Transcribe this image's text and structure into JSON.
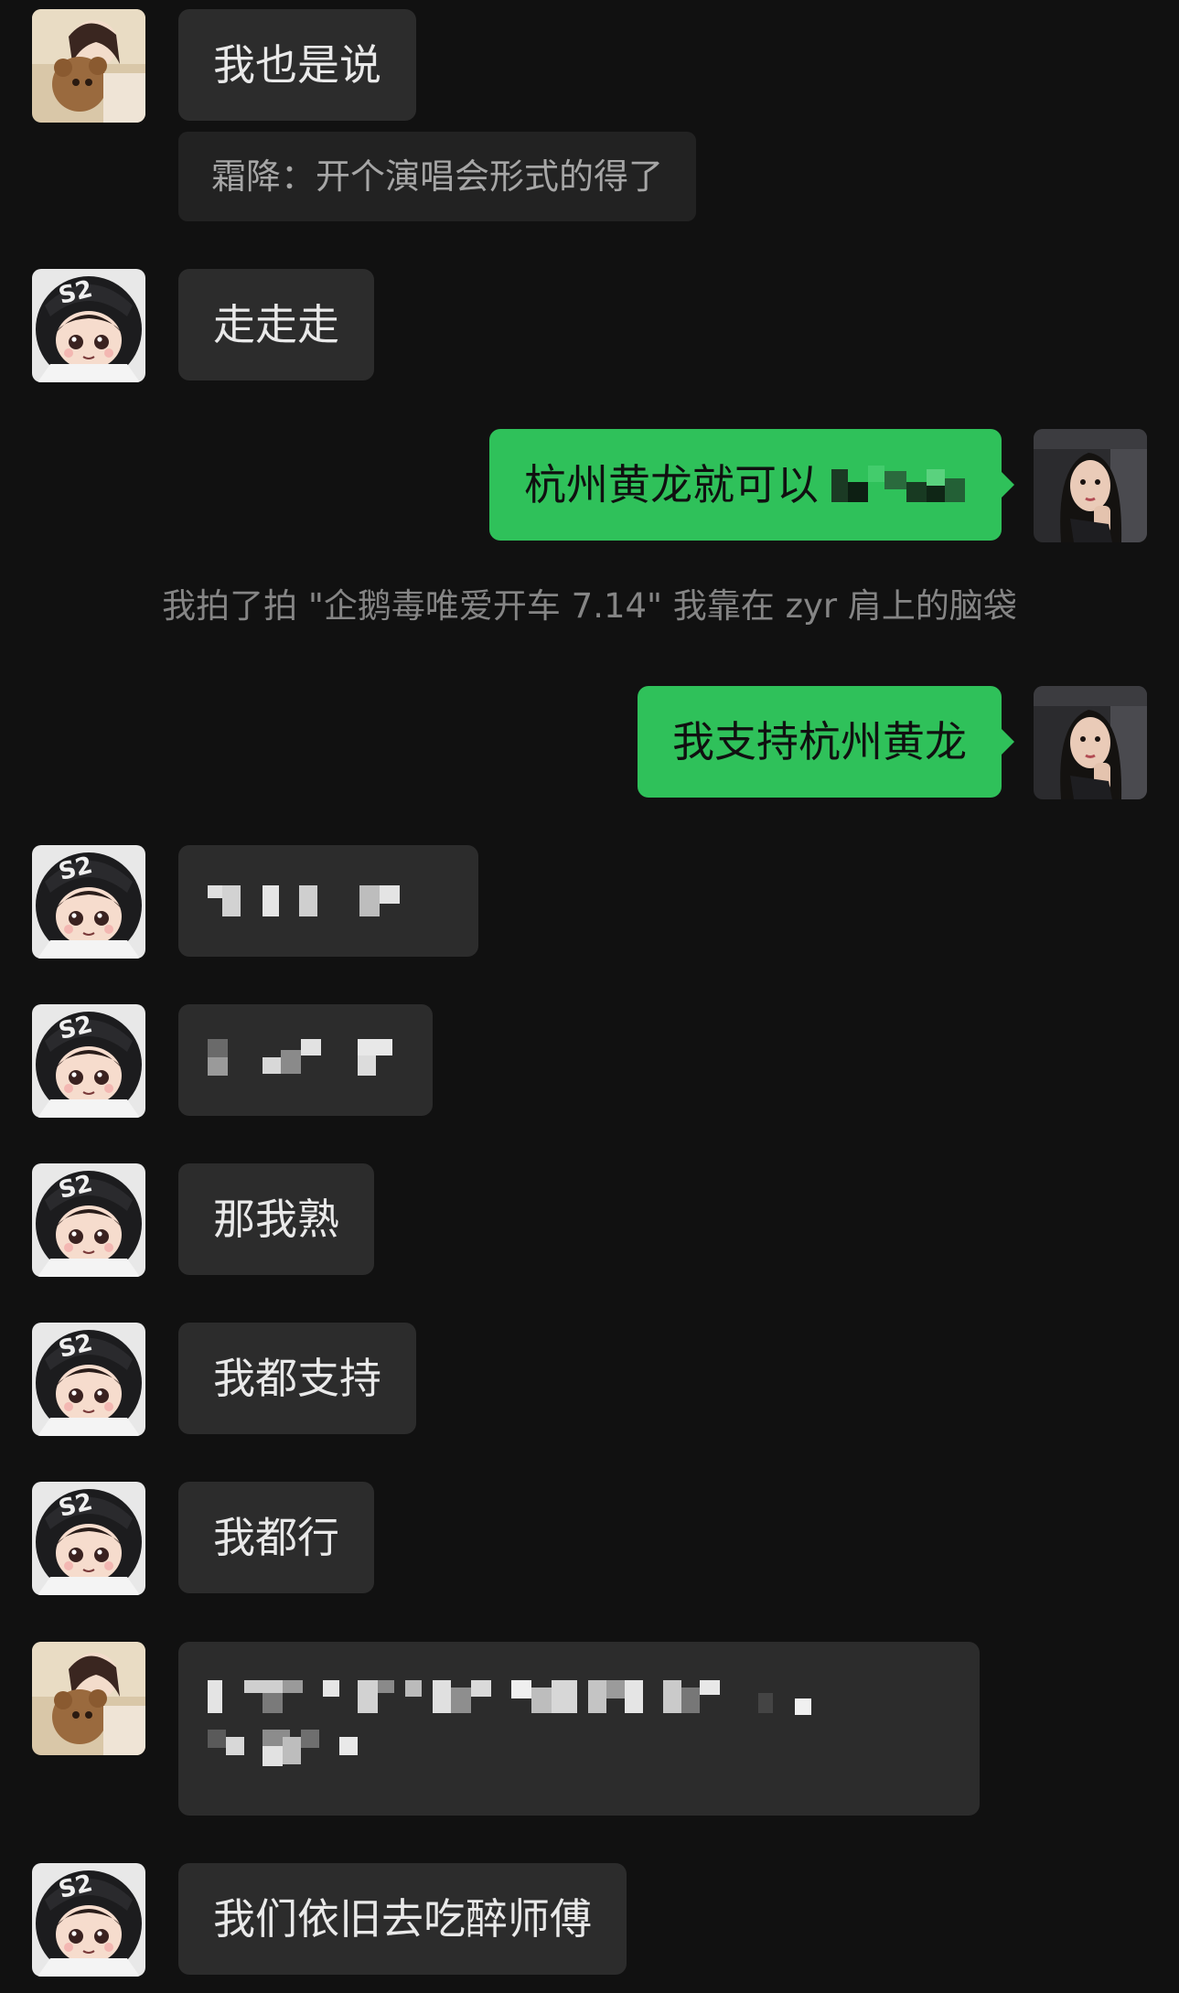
{
  "chat": {
    "messages": {
      "m1": {
        "text": "我也是说"
      },
      "m1_quote": {
        "text": "霜降：开个演唱会形式的得了"
      },
      "m2": {
        "text": "走走走"
      },
      "m3": {
        "text": "杭州黄龙就可以"
      },
      "system1": {
        "text": "我拍了拍 \"企鹅毒唯爱开车 7.14\" 我靠在 zyr 肩上的脑袋"
      },
      "m4": {
        "text": "我支持杭州黄龙"
      },
      "m7": {
        "text": "那我熟"
      },
      "m8": {
        "text": "我都支持"
      },
      "m9": {
        "text": "我都行"
      },
      "m11": {
        "text": "我们依旧去吃醉师傅"
      }
    }
  },
  "colors": {
    "background": "#111111",
    "incoming_bubble": "#2c2c2c",
    "outgoing_bubble": "#2fc15a",
    "quote_bubble": "#222222"
  },
  "icons": {
    "avatar_a": "girl-with-teddy-avatar-icon",
    "avatar_b": "helmet-girl-avatar-icon",
    "avatar_self": "dark-hair-woman-avatar-icon"
  }
}
